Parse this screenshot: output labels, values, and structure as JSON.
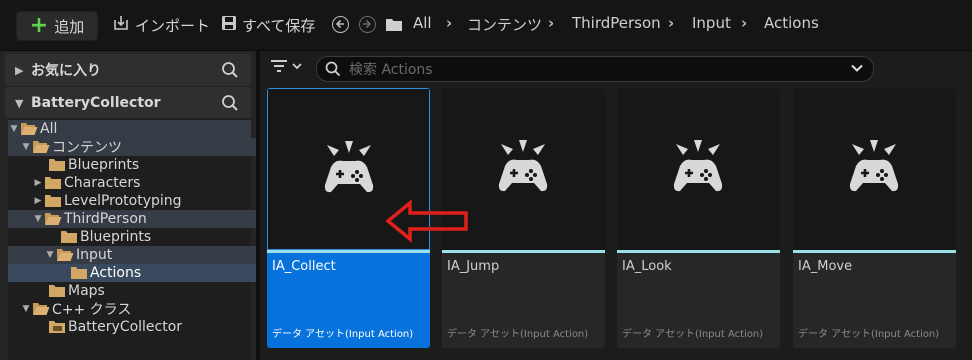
{
  "toolbar": {
    "add_label": "追加",
    "import_label": "インポート",
    "save_all_label": "すべて保存"
  },
  "breadcrumb": [
    "All",
    "コンテンツ",
    "ThirdPerson",
    "Input",
    "Actions"
  ],
  "favorites": {
    "label": "お気に入り"
  },
  "project": {
    "label": "BatteryCollector"
  },
  "tree": [
    {
      "label": "All"
    },
    {
      "label": "コンテンツ"
    },
    {
      "label": "Blueprints"
    },
    {
      "label": "Characters"
    },
    {
      "label": "LevelPrototyping"
    },
    {
      "label": "ThirdPerson"
    },
    {
      "label": "Blueprints"
    },
    {
      "label": "Input"
    },
    {
      "label": "Actions"
    },
    {
      "label": "Maps"
    },
    {
      "label": "C++ クラス"
    },
    {
      "label": "BatteryCollector"
    }
  ],
  "search": {
    "placeholder": "検索 Actions",
    "value": ""
  },
  "assets": [
    {
      "name": "IA_Collect",
      "type": "データ アセット(Input Action)",
      "selected": true
    },
    {
      "name": "IA_Jump",
      "type": "データ アセット(Input Action)",
      "selected": false
    },
    {
      "name": "IA_Look",
      "type": "データ アセット(Input Action)",
      "selected": false
    },
    {
      "name": "IA_Move",
      "type": "データ アセット(Input Action)",
      "selected": false
    }
  ],
  "colors": {
    "add_accent": "#5fd24a",
    "selection": "#0872dc",
    "asset_bar": "#9ae0e8",
    "annotation_arrow": "#e0201a"
  },
  "icons": {
    "add": "plus-icon",
    "import": "import-icon",
    "save": "save-icon",
    "back": "back-icon",
    "forward": "forward-icon",
    "folder": "folder-icon",
    "search": "search-icon",
    "filter": "filter-icon",
    "asset": "gamepad-icon"
  }
}
